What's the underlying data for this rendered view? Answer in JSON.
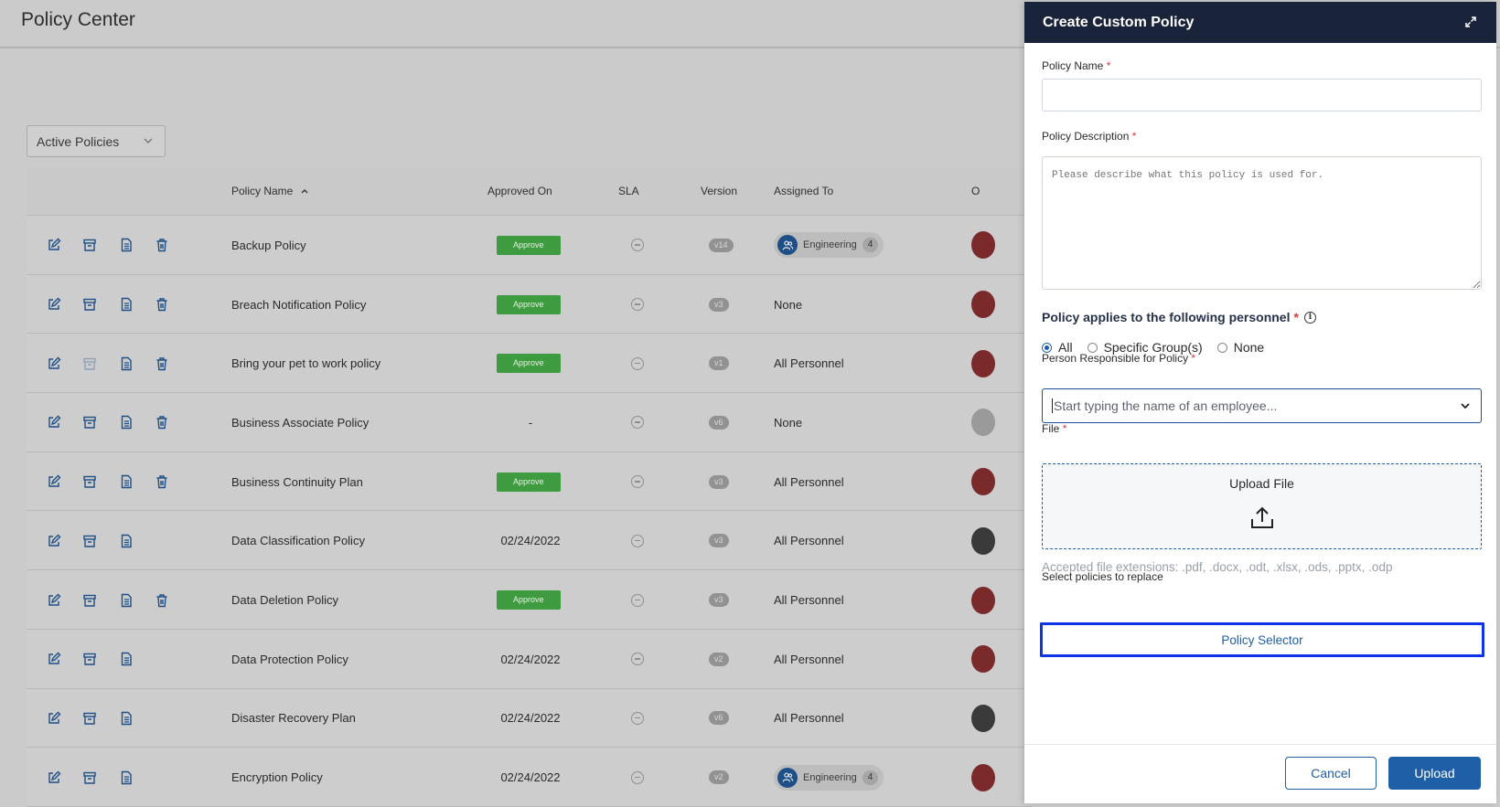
{
  "page": {
    "title": "Policy Center",
    "filter": "Active Policies"
  },
  "table": {
    "columns": [
      "Policy Name",
      "Approved On",
      "SLA",
      "Version",
      "Assigned To",
      "O"
    ],
    "rows": [
      {
        "name": "Backup Policy",
        "approved": "Approve",
        "approved_is_button": true,
        "version": "v14",
        "assigned": "Engineering",
        "assigned_count": "4",
        "assigned_is_group": true
      },
      {
        "name": "Breach Notification Policy",
        "approved": "Approve",
        "approved_is_button": true,
        "version": "v3",
        "assigned": "None",
        "assigned_is_group": false
      },
      {
        "name": "Bring your pet to work policy",
        "approved": "Approve",
        "approved_is_button": true,
        "version": "v1",
        "assigned": "All Personnel",
        "assigned_is_group": false
      },
      {
        "name": "Business Associate Policy",
        "approved": "-",
        "approved_is_button": false,
        "version": "v6",
        "assigned": "None",
        "assigned_is_group": false
      },
      {
        "name": "Business Continuity Plan",
        "approved": "Approve",
        "approved_is_button": true,
        "version": "v3",
        "assigned": "All Personnel",
        "assigned_is_group": false
      },
      {
        "name": "Data Classification Policy",
        "approved": "02/24/2022",
        "approved_is_button": false,
        "version": "v3",
        "assigned": "All Personnel",
        "assigned_is_group": false
      },
      {
        "name": "Data Deletion Policy",
        "approved": "Approve",
        "approved_is_button": true,
        "version": "v3",
        "assigned": "All Personnel",
        "assigned_is_group": false
      },
      {
        "name": "Data Protection Policy",
        "approved": "02/24/2022",
        "approved_is_button": false,
        "version": "v2",
        "assigned": "All Personnel",
        "assigned_is_group": false
      },
      {
        "name": "Disaster Recovery Plan",
        "approved": "02/24/2022",
        "approved_is_button": false,
        "version": "v6",
        "assigned": "All Personnel",
        "assigned_is_group": false
      },
      {
        "name": "Encryption Policy",
        "approved": "02/24/2022",
        "approved_is_button": false,
        "version": "v2",
        "assigned": "Engineering",
        "assigned_count": "4",
        "assigned_is_group": true
      }
    ]
  },
  "drawer": {
    "title": "Create Custom Policy",
    "policy_name_label": "Policy Name",
    "policy_name_value": "",
    "description_label": "Policy Description",
    "description_placeholder": "Please describe what this policy is used for.",
    "personnel_title": "Policy applies to the following personnel",
    "personnel_options": [
      "All",
      "Specific Group(s)",
      "None"
    ],
    "personnel_selected": "All",
    "responsible_label": "Person Responsible for Policy",
    "responsible_placeholder": "Start typing the name of an employee...",
    "file_label": "File",
    "upload_title": "Upload File",
    "accepted_hint": "Accepted file extensions: .pdf, .docx, .odt, .xlsx, .ods, .pptx, .odp",
    "replace_label": "Select policies to replace",
    "policy_selector": "Policy Selector",
    "required_mark": "*",
    "cancel": "Cancel",
    "upload": "Upload"
  },
  "colors": {
    "drawer_header": "#19233a",
    "accent": "#1e5fa8",
    "approve_green": "#3f9b3f",
    "required": "#d23b3b",
    "focus_outline": "#1133e6"
  }
}
